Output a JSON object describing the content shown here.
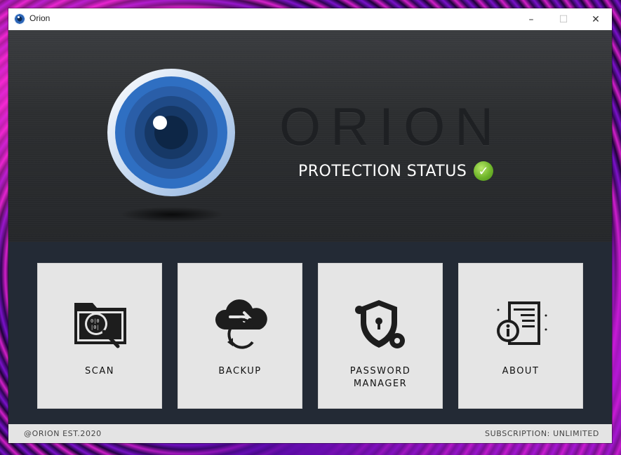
{
  "window": {
    "title": "Orion",
    "controls": {
      "minimize": "–",
      "maximize": "☐",
      "close": "✕"
    }
  },
  "hero": {
    "brand": "ORION",
    "status_text": "PROTECTION STATUS",
    "status_icon": "check-circle-icon",
    "status_color": "#6fb52a"
  },
  "tiles": [
    {
      "label": "SCAN",
      "icon": "folder-scan-icon"
    },
    {
      "label": "BACKUP",
      "icon": "cloud-sync-icon"
    },
    {
      "label_line1": "PASSWORD",
      "label_line2": "MANAGER",
      "icon": "shield-lock-icon"
    },
    {
      "label": "ABOUT",
      "icon": "info-document-icon"
    }
  ],
  "footer": {
    "left": "@ORION EST.2020",
    "right": "SUBSCRIPTION: UNLIMITED"
  },
  "colors": {
    "hero_bg": "#2c2e30",
    "panel_bg": "#232a35",
    "tile_bg": "#e5e5e5",
    "accent_blue": "#2a64b6"
  }
}
